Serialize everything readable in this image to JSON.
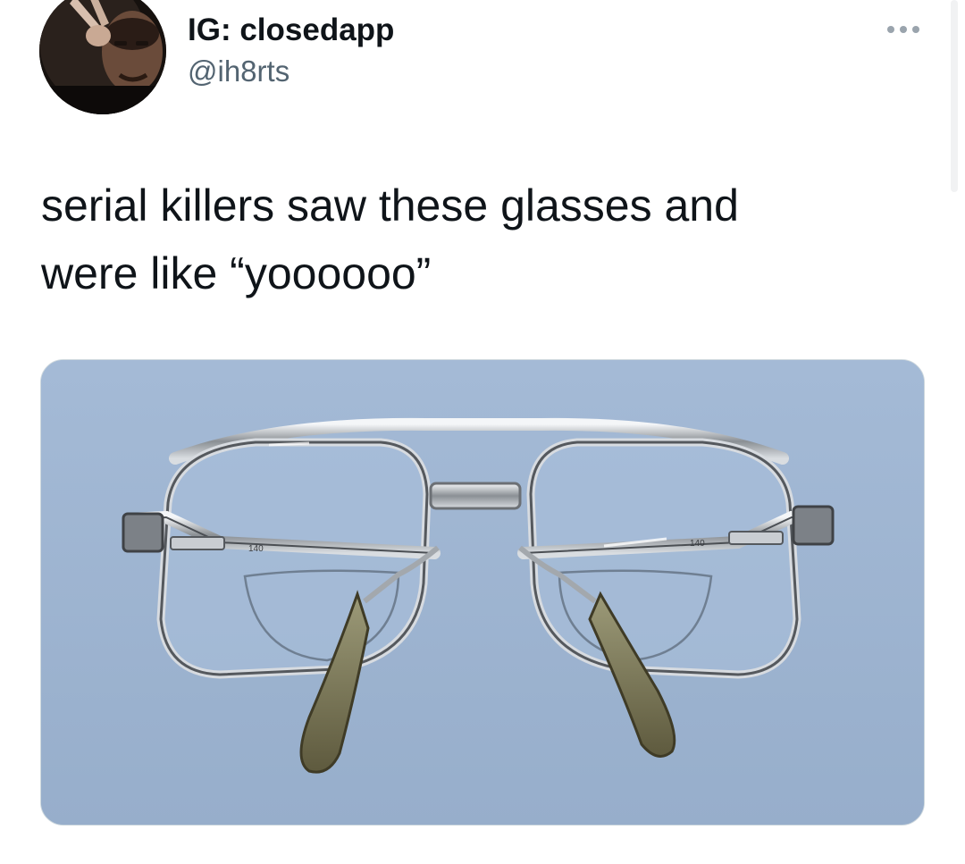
{
  "tweet": {
    "display_name": "IG: closedapp",
    "handle": "@ih8rts",
    "text": "serial killers saw these glasses and\nwere like “yoooooo”",
    "more_icon": "more-horizontal-icon"
  },
  "avatar": {
    "icon": "profile-photo"
  },
  "media": {
    "icon": "photo-eyeglasses",
    "temple_markings": [
      "140",
      "140"
    ]
  },
  "colors": {
    "text": "#0f1419",
    "secondary": "#536471",
    "photo_background": "#9db4d1"
  }
}
